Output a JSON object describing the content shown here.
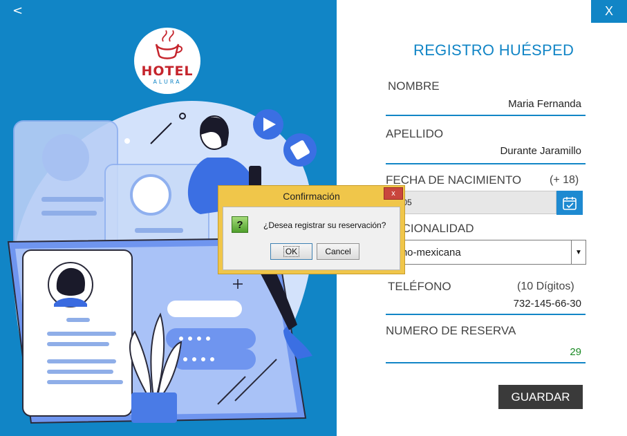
{
  "window": {
    "back_label": "<",
    "close_label": "X"
  },
  "logo": {
    "text": "HOTEL",
    "subtext": "ALURA"
  },
  "form": {
    "title": "REGISTRO HUÉSPED",
    "nombre_label": "NOMBRE",
    "nombre_value": "Maria Fernanda",
    "apellido_label": "APELLIDO",
    "apellido_value": "Durante Jaramillo",
    "fecha_label": "FECHA DE NACIMIENTO",
    "fecha_hint": "(+ 18)",
    "fecha_value": "09-05",
    "nacionalidad_label": "NACIONALIDAD",
    "nacionalidad_value": "cano-mexicana",
    "telefono_label": "TELÉFONO",
    "telefono_hint": "(10 Dígitos)",
    "telefono_value": "732-145-66-30",
    "reserva_label": "NUMERO DE RESERVA",
    "reserva_value": "29",
    "save_label": "GUARDAR"
  },
  "dialog": {
    "title": "Confirmación",
    "close_label": "x",
    "icon_glyph": "?",
    "message": "¿Desea registrar su reservación?",
    "ok_label": "OK",
    "cancel_label": "Cancel"
  },
  "colors": {
    "brand_blue": "#1185c6",
    "dark_button": "#3a3a3a",
    "dialog_frame": "#f0c64a",
    "reserve_green": "#1a8a24"
  },
  "icons": [
    "back-icon",
    "close-icon",
    "calendar-icon",
    "dropdown-arrow-icon",
    "question-icon",
    "coffee-cup-icon",
    "play-icon",
    "clock-icon"
  ]
}
